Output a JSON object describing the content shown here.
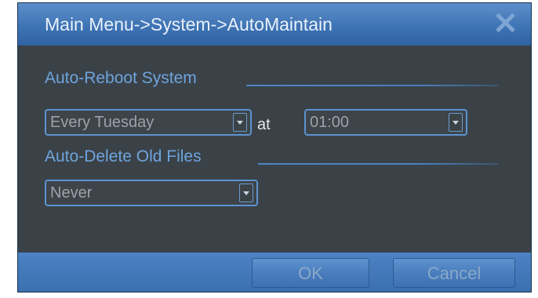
{
  "window": {
    "title": "Main Menu->System->AutoMaintain",
    "close_icon": "close-icon"
  },
  "auto_reboot": {
    "label": "Auto-Reboot System",
    "day_value": "Every Tuesday",
    "at_label": "at",
    "time_value": "01:00"
  },
  "auto_delete": {
    "label": "Auto-Delete Old Files",
    "value": "Never"
  },
  "buttons": {
    "ok": "OK",
    "cancel": "Cancel"
  },
  "colors": {
    "titlebar": "#3f74b4",
    "panel_bg": "#3a4248",
    "accent": "#6ea4dc"
  }
}
